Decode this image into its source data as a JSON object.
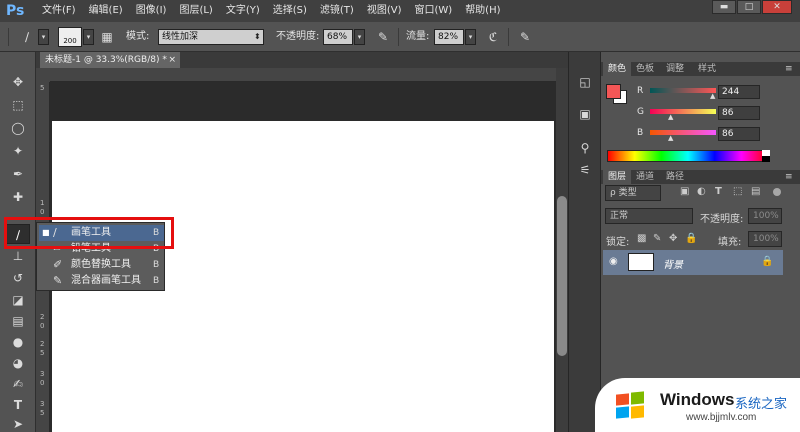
{
  "app": {
    "logo": "Ps"
  },
  "menu": [
    "文件(F)",
    "编辑(E)",
    "图像(I)",
    "图层(L)",
    "文字(Y)",
    "选择(S)",
    "滤镜(T)",
    "视图(V)",
    "窗口(W)",
    "帮助(H)"
  ],
  "window_controls": {
    "minimize": "▬",
    "maximize": "□",
    "close": "✕"
  },
  "options": {
    "brush_size": "200",
    "mode_label": "模式:",
    "mode_value": "线性加深",
    "opacity_label": "不透明度:",
    "opacity_value": "68%",
    "flow_label": "流量:",
    "flow_value": "82%"
  },
  "document": {
    "tab_label": "未标题-1 @ 33.3%(RGB/8) *",
    "tab_close": "×"
  },
  "ruler": {
    "left_marks": [
      "5",
      "1",
      "0",
      "1",
      "5",
      "2",
      "0",
      "2",
      "5",
      "3",
      "0",
      "3",
      "5"
    ]
  },
  "flyout": {
    "items": [
      {
        "label": "画笔工具",
        "key": "B",
        "bullet": "■"
      },
      {
        "label": "铅笔工具",
        "key": "B",
        "bullet": ""
      },
      {
        "label": "颜色替换工具",
        "key": "B",
        "bullet": ""
      },
      {
        "label": "混合器画笔工具",
        "key": "B",
        "bullet": ""
      }
    ]
  },
  "color_panel": {
    "tabs": [
      "颜色",
      "色板",
      "调整",
      "样式"
    ],
    "R": {
      "label": "R",
      "value": "244"
    },
    "G": {
      "label": "G",
      "value": "86"
    },
    "B": {
      "label": "B",
      "value": "86"
    },
    "foreground": "#f45656"
  },
  "layers_panel": {
    "tabs": [
      "图层",
      "通道",
      "路径"
    ],
    "filter_label": "ρ 类型",
    "blend_mode": "正常",
    "opacity_label": "不透明度:",
    "opacity_value": "100%",
    "lock_label": "锁定:",
    "fill_label": "填充:",
    "fill_value": "100%",
    "layer_name": "背景"
  },
  "watermark": {
    "brand": "Windows",
    "brand_cn": "系统之家",
    "url": "www.bjjmlv.com"
  }
}
